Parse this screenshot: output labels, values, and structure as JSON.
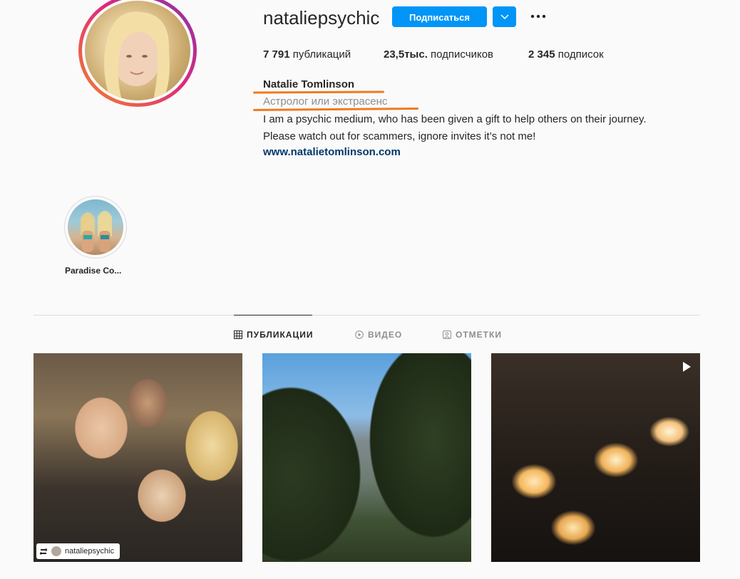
{
  "profile": {
    "username": "nataliepsychic",
    "follow_label": "Подписаться",
    "stats": {
      "posts_value": "7 791",
      "posts_label": "публикаций",
      "followers_value": "23,5тыс.",
      "followers_label": "подписчиков",
      "following_value": "2 345",
      "following_label": "подписок"
    },
    "full_name": "Natalie Tomlinson",
    "category": "Астролог или экстрасенс",
    "bio_line1": "I am a psychic medium, who has been given a gift to help others on their journey.",
    "bio_line2": "Please watch out for scammers, ignore invites it’s not me!",
    "website": "www.natalietomlinson.com"
  },
  "highlights": [
    {
      "label": "Paradise Co..."
    }
  ],
  "tabs": [
    {
      "label": "ПУБЛИКАЦИИ",
      "icon": "grid-icon",
      "active": true
    },
    {
      "label": "ВИДЕО",
      "icon": "video-icon",
      "active": false
    },
    {
      "label": "ОТМЕТКИ",
      "icon": "tagged-icon",
      "active": false
    }
  ],
  "posts": [
    {
      "repost_username": "nataliepsychic"
    },
    {},
    {
      "type_icon": "video-icon"
    }
  ],
  "colors": {
    "accent": "#0095f6",
    "annotation_underline": "#f07a1f",
    "link": "#00376b"
  }
}
